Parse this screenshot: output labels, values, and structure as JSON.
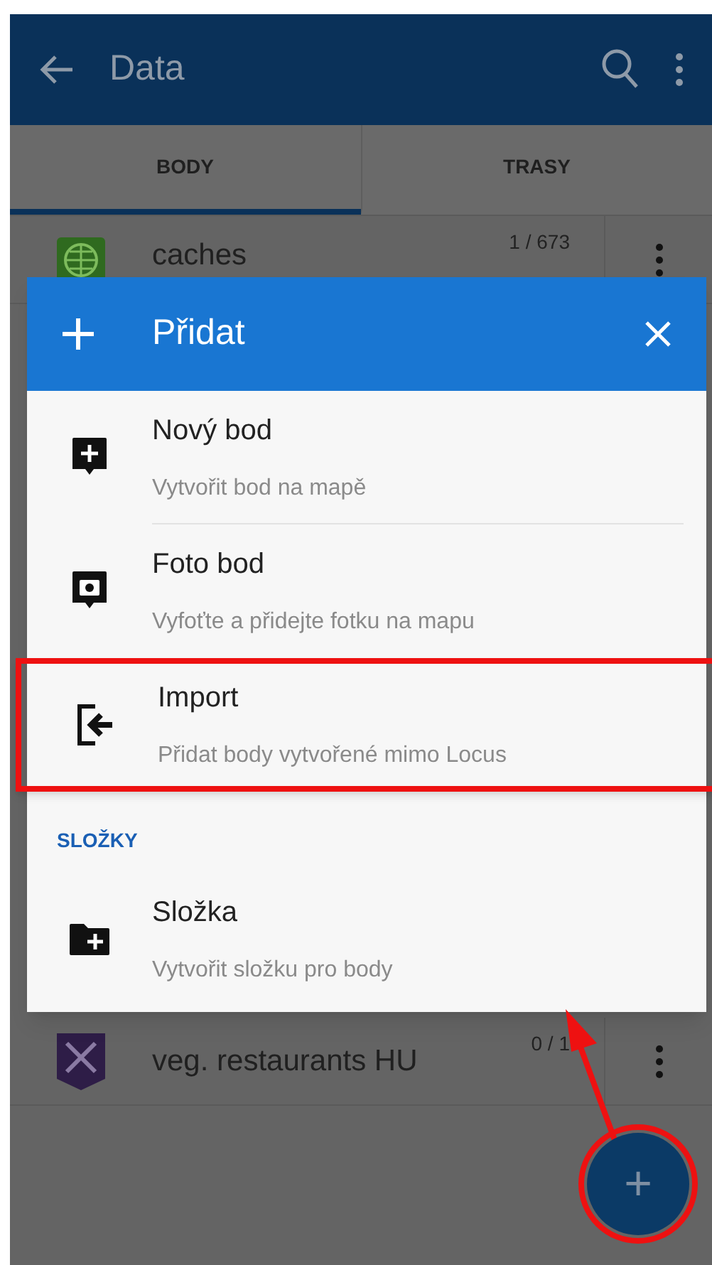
{
  "app_bar": {
    "title": "Data"
  },
  "tabs": [
    {
      "label": "BODY",
      "selected": true
    },
    {
      "label": "TRASY",
      "selected": false
    }
  ],
  "rows": [
    {
      "name": "caches",
      "count": "1 / 673"
    },
    {
      "name": "veg. restaurants HU",
      "count": "0 / 1"
    }
  ],
  "dialog": {
    "title": "Přidat",
    "items": [
      {
        "kind": "item",
        "title": "Nový bod",
        "subtitle": "Vytvořit bod na mapě",
        "highlighted": false
      },
      {
        "kind": "item",
        "title": "Foto bod",
        "subtitle": "Vyfoťte a přidejte fotku na mapu",
        "highlighted": false
      },
      {
        "kind": "item",
        "title": "Import",
        "subtitle": "Přidat body vytvořené mimo Locus",
        "highlighted": true
      },
      {
        "kind": "section",
        "title": "SLOŽKY"
      },
      {
        "kind": "item",
        "title": "Složka",
        "subtitle": "Vytvořit složku pro body",
        "highlighted": false
      }
    ]
  },
  "fab": {
    "label": "+"
  }
}
